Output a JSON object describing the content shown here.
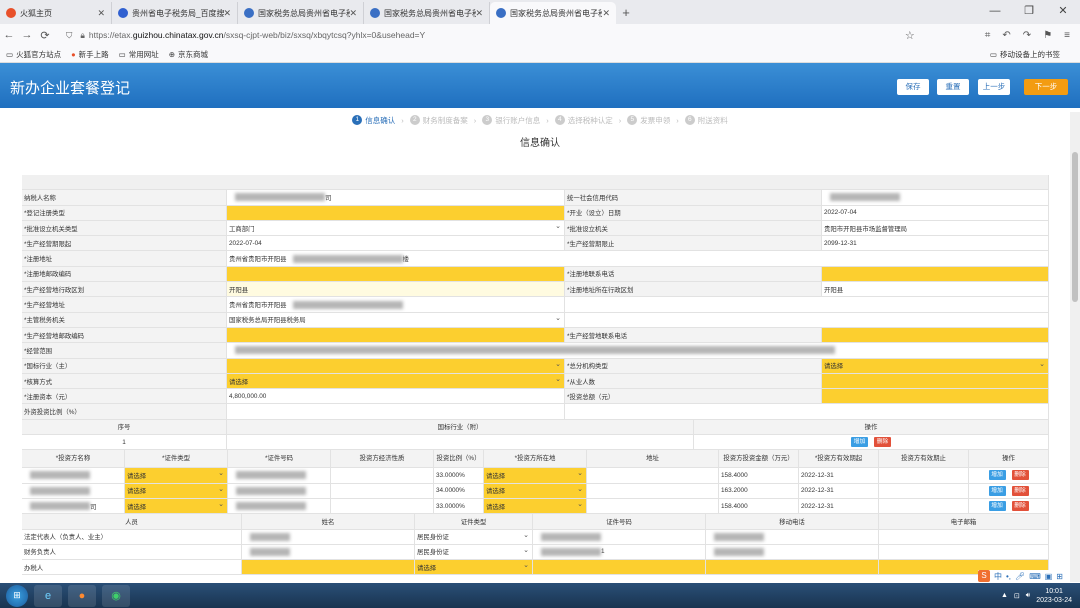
{
  "browser": {
    "tabs": [
      {
        "label": "火狐主页",
        "color": "#e8502a",
        "active": false
      },
      {
        "label": "贵州省电子税务局_百度搜索",
        "color": "#3060d0",
        "active": false
      },
      {
        "label": "国家税务总局贵州省电子税务局",
        "color": "#3a6fc4",
        "active": false
      },
      {
        "label": "国家税务总局贵州省电子税务局",
        "color": "#3a6fc4",
        "active": false
      },
      {
        "label": "国家税务总局贵州省电子税务局",
        "color": "#3a6fc4",
        "active": true
      }
    ],
    "url_pre": "https://etax.",
    "url_host": "guizhou.chinatax.gov.cn",
    "url_post": "/sxsq-cjpt-web/biz/sxsq/xbqytcsq?yhlx=0&usehead=Y",
    "bookmarks": [
      "火狐官方站点",
      "新手上路",
      "常用网址",
      "京东商城"
    ],
    "mobile_bookmarks": "移动设备上的书签"
  },
  "header": {
    "title": "新办企业套餐登记",
    "save": "保存",
    "reset": "重置",
    "prev": "上一步",
    "next": "下一步"
  },
  "steps": [
    "信息确认",
    "财务制度备案",
    "银行账户信息",
    "选择税种认定",
    "发票申领",
    "附送资料"
  ],
  "page_title": "信息确认",
  "rows": [
    {
      "l1": "纳税人名称",
      "v1": "",
      "b1": true,
      "v1s": "司",
      "l2": "统一社会信用代码",
      "v2": "",
      "b2": true
    },
    {
      "l1": "*登记注册类型",
      "v1": "",
      "y1": true,
      "l2": "*开业（设立）日期",
      "v2": "2022-07-04"
    },
    {
      "l1": "*批准设立机关类型",
      "v1": "工商部门",
      "dd1": true,
      "l2": "*批准设立机关",
      "v2": "贵阳市开阳县市场监督管理局"
    },
    {
      "l1": "*生产经营期限起",
      "v1": "2022-07-04",
      "l2": "*生产经营期限止",
      "v2": "2099-12-31"
    },
    {
      "l1": "*注册地址",
      "v1": "贵州省贵阳市开阳县",
      "wide1": true,
      "v1s": "楼"
    },
    {
      "l1": "*注册地邮政编码",
      "v1": "",
      "y1": true,
      "l2": "*注册地联系电话",
      "v2": "",
      "y2": true
    },
    {
      "l1": "*生产经营地行政区划",
      "v1": "开阳县",
      "ly1": true,
      "l2": "*注册地址所在行政区划",
      "v2": "开阳县"
    },
    {
      "l1": "*生产经营地址",
      "v1": "贵州省贵阳市开阳县",
      "wide1": false
    },
    {
      "l1": "*主管税务机关",
      "v1": "国家税务总局开阳县税务局",
      "dd1": true
    },
    {
      "l1": "*生产经营地邮政编码",
      "v1": "",
      "y1": true,
      "l2": "*生产经营地联系电话",
      "v2": "",
      "y2": true
    },
    {
      "l1": "*经营范围",
      "v1": "",
      "scope": true
    },
    {
      "l1": "*国标行业（主）",
      "v1": "",
      "y1": true,
      "dd1": true,
      "l2": "*总分机构类型",
      "v2": "请选择",
      "y2": true,
      "dd2": true
    },
    {
      "l1": "*核算方式",
      "v1": "请选择",
      "y1": true,
      "dd1": true,
      "l2": "*从业人数",
      "v2": "",
      "y2": true
    },
    {
      "l1": "*注册资本（元）",
      "v1": "4,800,000.00",
      "l2": "*投资总额（元）",
      "v2": "",
      "y2": true
    },
    {
      "l1": "外资投资比例（%）",
      "v1": ""
    }
  ],
  "industry": {
    "h_no": "序号",
    "h_industry": "国标行业（附）",
    "h_op": "操作",
    "no": "1",
    "add": "增加",
    "del": "删除"
  },
  "investors": {
    "headers": [
      "*投资方名称",
      "*证件类型",
      "*证件号码",
      "投资方经济性质",
      "投资比例（%）",
      "*投资方所在地",
      "地址",
      "投资方投资金额（万元）",
      "*投资方有效期起",
      "投资方有效期止",
      "操作"
    ],
    "rows": [
      {
        "type": "请选择",
        "ratio": "33.0000%",
        "loc": "请选择",
        "amount": "158.4000",
        "start": "2022-12-31"
      },
      {
        "type": "请选择",
        "ratio": "34.0000%",
        "loc": "请选择",
        "amount": "163.2000",
        "start": "2022-12-31"
      },
      {
        "type": "请选择",
        "ratio": "33.0000%",
        "loc": "请选择",
        "amount": "158.4000",
        "start": "2022-12-31",
        "name_tail": "司"
      }
    ],
    "add": "增加",
    "del": "删除"
  },
  "persons": {
    "headers": [
      "人员",
      "姓名",
      "证件类型",
      "证件号码",
      "移动电话",
      "电子邮箱"
    ],
    "rows": [
      {
        "role": "法定代表人（负责人、业主）",
        "idtype": "居民身份证"
      },
      {
        "role": "财务负责人",
        "idtype": "居民身份证",
        "idtail": "1"
      },
      {
        "role": "办税人",
        "idtype": "请选择",
        "yellow": true
      }
    ]
  },
  "taskbar": {
    "time": "10:01",
    "date": "2023-03-24",
    "ime": "中"
  }
}
